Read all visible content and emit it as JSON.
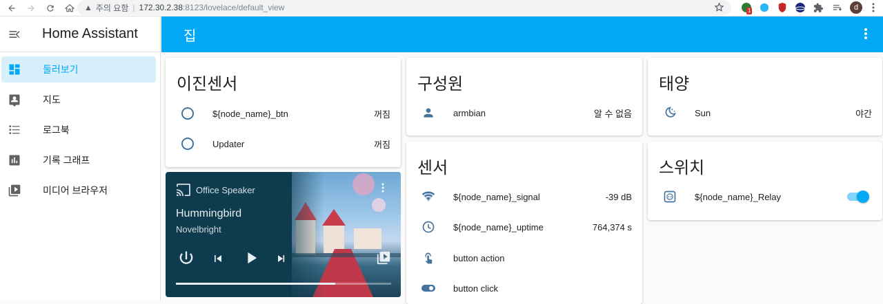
{
  "browser": {
    "warning": "주의 요함",
    "url_host": "172.30.2.38",
    "url_rest": ":8123/lovelace/default_view",
    "ext_badge": "1",
    "profile_letter": "d"
  },
  "sidebar": {
    "title": "Home Assistant",
    "items": [
      {
        "label": "둘러보기",
        "icon": "dashboard-icon",
        "active": true
      },
      {
        "label": "지도",
        "icon": "account-box-icon",
        "active": false
      },
      {
        "label": "로그북",
        "icon": "format-list-icon",
        "active": false
      },
      {
        "label": "기록 그래프",
        "icon": "chart-bar-icon",
        "active": false
      },
      {
        "label": "미디어 브라우저",
        "icon": "play-box-multiple-icon",
        "active": false
      }
    ]
  },
  "header": {
    "title": "집"
  },
  "binary_sensors": {
    "title": "이진센서",
    "rows": [
      {
        "name": "${node_name}_btn",
        "state": "꺼짐",
        "icon": "radiobox-blank-icon"
      },
      {
        "name": "Updater",
        "state": "꺼짐",
        "icon": "radiobox-blank-icon"
      }
    ]
  },
  "media_player": {
    "device": "Office Speaker",
    "track": "Hummingbird",
    "artist": "Novelbright",
    "progress": 0.74
  },
  "people": {
    "title": "구성원",
    "rows": [
      {
        "name": "armbian",
        "state": "알 수 없음",
        "icon": "account-icon"
      }
    ]
  },
  "sensors": {
    "title": "센서",
    "rows": [
      {
        "name": "${node_name}_signal",
        "state": "-39 dB",
        "icon": "wifi-icon"
      },
      {
        "name": "${node_name}_uptime",
        "state": "764,374 s",
        "icon": "clock-icon"
      },
      {
        "name": "button action",
        "state": "",
        "icon": "gesture-tap-icon"
      },
      {
        "name": "button click",
        "state": "",
        "icon": "toggle-switch-icon"
      }
    ]
  },
  "sun": {
    "title": "태양",
    "rows": [
      {
        "name": "Sun",
        "state": "야간",
        "icon": "weather-night-icon"
      }
    ]
  },
  "switches": {
    "title": "스위치",
    "rows": [
      {
        "name": "${node_name}_Relay",
        "state_on": true,
        "icon": "power-socket-icon"
      }
    ]
  },
  "colors": {
    "accent": "#03a9f4",
    "icon": "#44739e",
    "sidebar_active_bg": "#d7effa"
  }
}
